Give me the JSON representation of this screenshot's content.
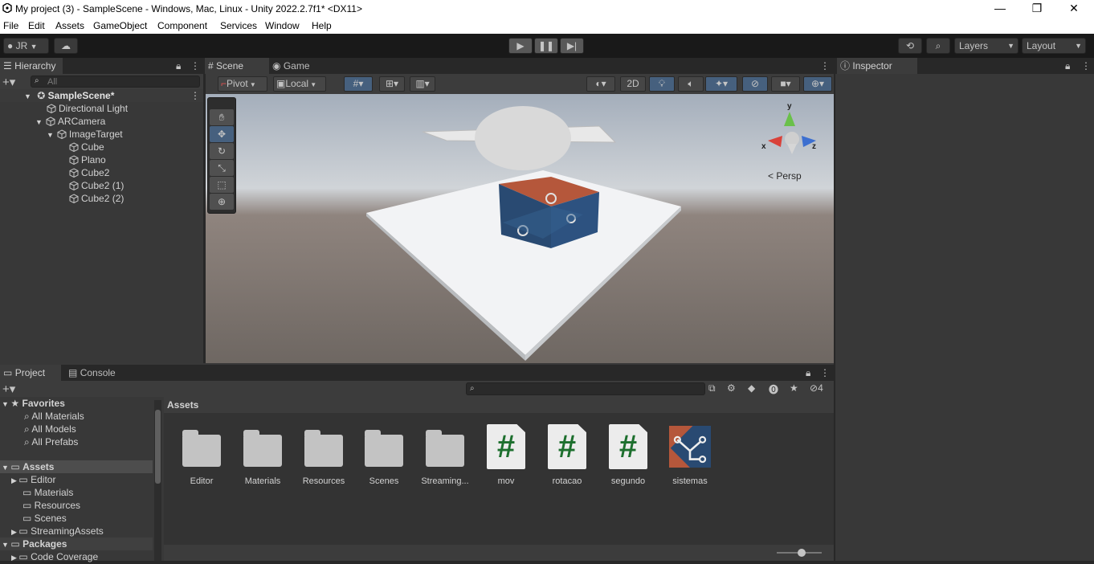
{
  "window": {
    "title": "My project (3) - SampleScene - Windows, Mac, Linux - Unity 2022.2.7f1* <DX11>",
    "minimize": "—",
    "maximize": "❐",
    "close": "✕"
  },
  "menu": [
    "File",
    "Edit",
    "Assets",
    "GameObject",
    "Component",
    "Services",
    "Window",
    "Help"
  ],
  "toolbar": {
    "account": "JR",
    "layers": "Layers",
    "layout": "Layout"
  },
  "hierarchy": {
    "tab": "Hierarchy",
    "search_placeholder": "All",
    "scene": "SampleScene*",
    "items": [
      {
        "label": "Directional Light"
      },
      {
        "label": "ARCamera"
      },
      {
        "label": "ImageTarget"
      },
      {
        "label": "Cube"
      },
      {
        "label": "Plano"
      },
      {
        "label": "Cube2"
      },
      {
        "label": "Cube2 (1)"
      },
      {
        "label": "Cube2 (2)"
      }
    ]
  },
  "scene": {
    "tabs": [
      "Scene",
      "Game"
    ],
    "pivot": "Pivot",
    "local": "Local",
    "mode_2d": "2D",
    "persp": "Persp",
    "axis_x": "x",
    "axis_y": "y",
    "axis_z": "z"
  },
  "inspector": {
    "tab": "Inspector"
  },
  "project": {
    "tabs": [
      "Project",
      "Console"
    ],
    "hidden_count": "4",
    "favorites": {
      "label": "Favorites",
      "items": [
        "All Materials",
        "All Models",
        "All Prefabs"
      ]
    },
    "assets_tree": {
      "label": "Assets",
      "items": [
        "Editor",
        "Materials",
        "Resources",
        "Scenes",
        "StreamingAssets"
      ]
    },
    "packages": {
      "label": "Packages",
      "items": [
        "Code Coverage"
      ]
    },
    "breadcrumb": "Assets",
    "assets": [
      {
        "name": "Editor",
        "type": "folder"
      },
      {
        "name": "Materials",
        "type": "folder"
      },
      {
        "name": "Resources",
        "type": "folder"
      },
      {
        "name": "Scenes",
        "type": "folder"
      },
      {
        "name": "Streaming...",
        "type": "folder"
      },
      {
        "name": "mov",
        "type": "script"
      },
      {
        "name": "rotacao",
        "type": "script"
      },
      {
        "name": "segundo",
        "type": "script"
      },
      {
        "name": "sistemas",
        "type": "texture"
      }
    ],
    "script_glyph": "#"
  },
  "colors": {
    "accent": "#3a72b0",
    "texture_blue": "#294a72",
    "texture_red": "#b5573b"
  }
}
